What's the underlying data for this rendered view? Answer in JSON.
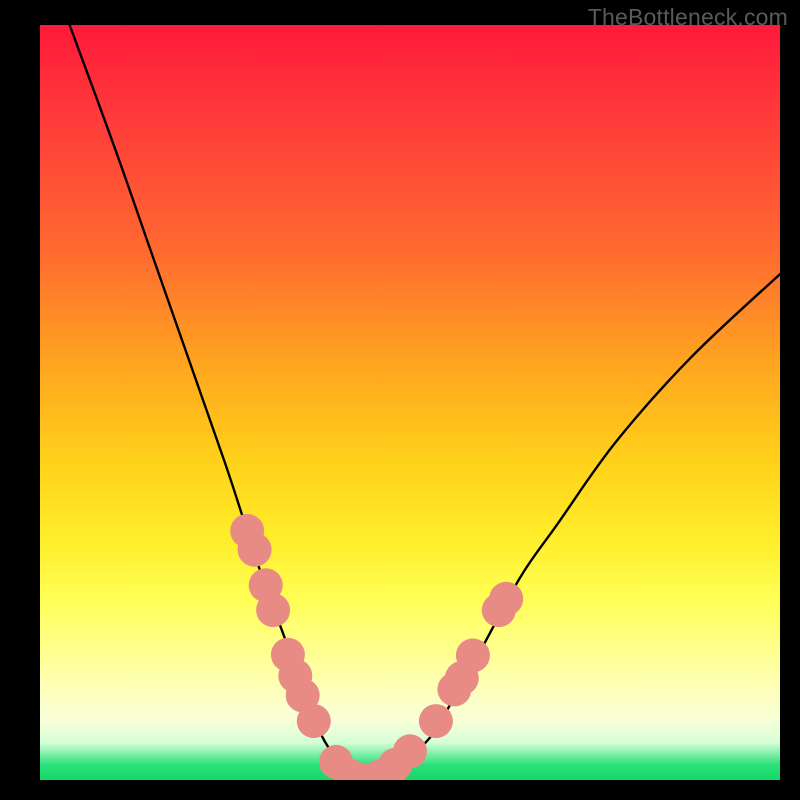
{
  "watermark": "TheBottleneck.com",
  "chart_data": {
    "type": "line",
    "title": "",
    "xlabel": "",
    "ylabel": "",
    "xlim": [
      0,
      100
    ],
    "ylim": [
      0,
      100
    ],
    "grid": false,
    "legend": false,
    "background_gradient": {
      "top": "#ff1a3a",
      "mid": "#ffff55",
      "bottom": "#15d86a",
      "note": "vertical red→yellow→green heat gradient"
    },
    "series": [
      {
        "name": "bottleneck-curve",
        "note": "V-shaped curve; y ≈ bottleneck % vs x (component balance). Minimum ~0 near x≈43.",
        "x": [
          4,
          10,
          15,
          20,
          25,
          28,
          30,
          33,
          36,
          38,
          40,
          42,
          44,
          46,
          48,
          50,
          53,
          56,
          60,
          65,
          70,
          78,
          88,
          100
        ],
        "values": [
          100,
          84,
          70,
          56,
          42,
          33,
          27,
          19,
          11,
          6,
          3,
          1,
          0,
          0,
          1,
          3,
          6,
          11,
          18,
          27,
          34,
          45,
          56,
          67
        ]
      }
    ],
    "markers": {
      "name": "highlighted-dots",
      "color": "#e88b85",
      "radius": 2.3,
      "points": [
        {
          "x": 28.0,
          "y": 33.0
        },
        {
          "x": 29.0,
          "y": 30.5
        },
        {
          "x": 30.5,
          "y": 25.8
        },
        {
          "x": 31.5,
          "y": 22.5
        },
        {
          "x": 33.5,
          "y": 16.6
        },
        {
          "x": 34.5,
          "y": 13.8
        },
        {
          "x": 35.5,
          "y": 11.2
        },
        {
          "x": 37.0,
          "y": 7.8
        },
        {
          "x": 40.0,
          "y": 2.4
        },
        {
          "x": 42.0,
          "y": 0.5
        },
        {
          "x": 44.0,
          "y": 0.0
        },
        {
          "x": 46.0,
          "y": 0.5
        },
        {
          "x": 48.0,
          "y": 2.0
        },
        {
          "x": 50.0,
          "y": 3.8
        },
        {
          "x": 53.5,
          "y": 7.8
        },
        {
          "x": 56.0,
          "y": 12.0
        },
        {
          "x": 57.0,
          "y": 13.5
        },
        {
          "x": 58.5,
          "y": 16.5
        },
        {
          "x": 62.0,
          "y": 22.5
        },
        {
          "x": 63.0,
          "y": 24.0
        }
      ]
    }
  }
}
